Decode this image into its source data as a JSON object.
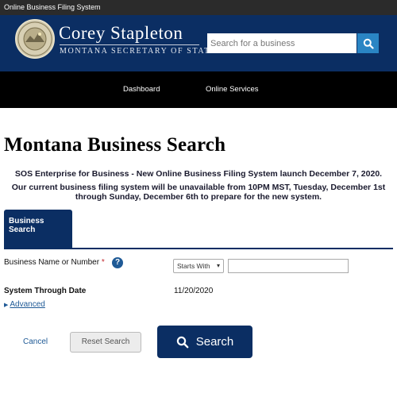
{
  "window": {
    "title": "Online Business Filing System"
  },
  "header": {
    "brand_name": "Corey Stapleton",
    "brand_sub": "MONTANA SECRETARY OF STATE",
    "search": {
      "placeholder": "Search for a business",
      "value": ""
    },
    "colors": {
      "navy": "#0b2e63",
      "search_button": "#2a85c4"
    }
  },
  "nav": {
    "items": [
      {
        "label": "Dashboard"
      },
      {
        "label": "Online Services"
      }
    ]
  },
  "page": {
    "title": "Montana Business Search",
    "notices": [
      "SOS Enterprise for Business - New Online Business Filing System launch December 7, 2020.",
      "Our current business filing system will be unavailable from 10PM MST, Tuesday, December 1st",
      "through Sunday, December 6th to prepare for the new system."
    ]
  },
  "tabs": [
    {
      "label_line1": "Business",
      "label_line2": "Search",
      "active": true
    }
  ],
  "form": {
    "name_label": "Business Name or Number",
    "required_mark": "*",
    "help_icon": "?",
    "match_select": {
      "selected": "Starts With",
      "icon": "chevron-down-icon"
    },
    "name_input": {
      "value": ""
    },
    "system_date_label": "System Through Date",
    "system_date_value": "11/20/2020",
    "advanced_label": "Advanced"
  },
  "actions": {
    "cancel": "Cancel",
    "reset": "Reset Search",
    "search": "Search"
  }
}
